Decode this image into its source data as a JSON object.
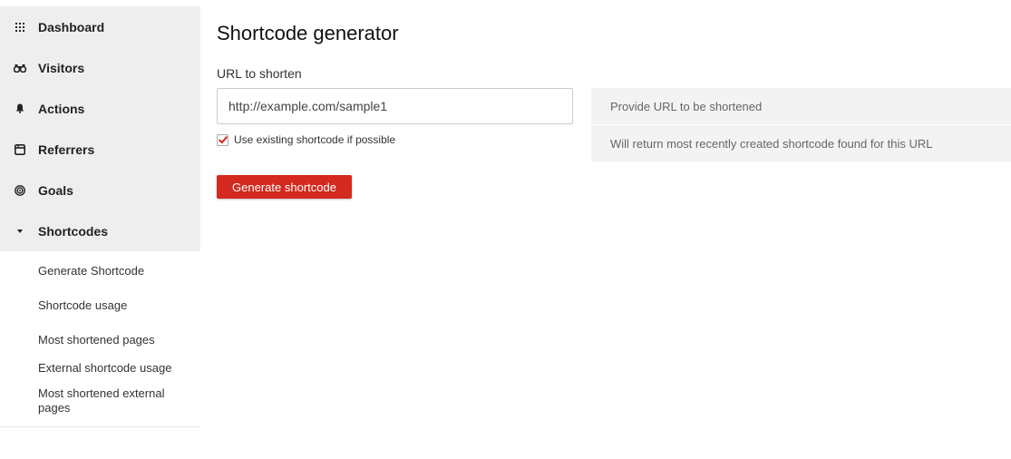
{
  "sidebar": {
    "items": [
      {
        "label": "Dashboard",
        "icon": "dashboard-grid-icon"
      },
      {
        "label": "Visitors",
        "icon": "binoculars-icon"
      },
      {
        "label": "Actions",
        "icon": "bell-icon"
      },
      {
        "label": "Referrers",
        "icon": "referrers-window-icon"
      },
      {
        "label": "Goals",
        "icon": "target-icon"
      },
      {
        "label": "Shortcodes",
        "icon": "caret-down-icon"
      }
    ],
    "submenu": [
      {
        "label": "Generate Shortcode"
      },
      {
        "label": "Shortcode usage"
      },
      {
        "label": "Most shortened pages"
      },
      {
        "label": "External shortcode usage"
      },
      {
        "label": "Most shortened external pages"
      }
    ]
  },
  "main": {
    "title": "Shortcode generator",
    "url_label": "URL to shorten",
    "url_value": "http://example.com/sample1",
    "checkbox_label": "Use existing shortcode if possible",
    "checkbox_checked": true,
    "button_label": "Generate shortcode"
  },
  "help": {
    "line1": "Provide URL to be shortened",
    "line2": "Will return most recently created shortcode found for this URL"
  },
  "colors": {
    "accent": "#d4291f",
    "sidebar_bg": "#eeeeee",
    "help_bg": "#f3f3f3"
  }
}
